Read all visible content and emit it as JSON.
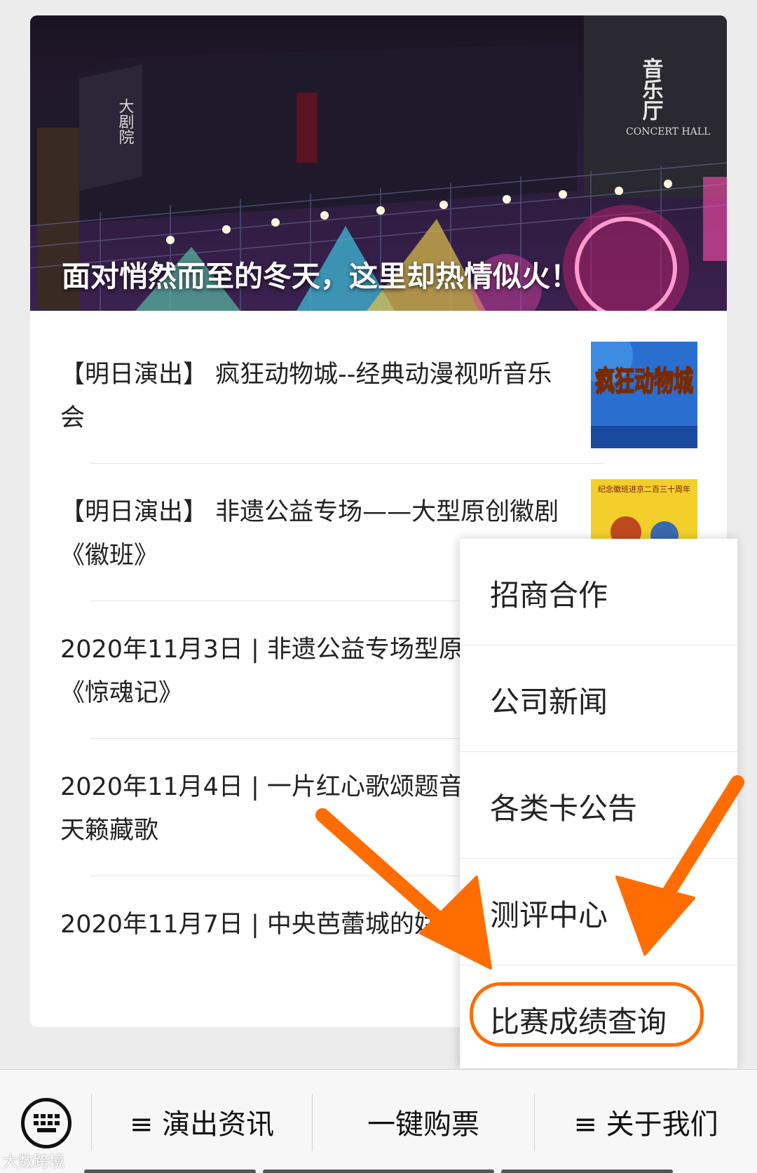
{
  "hero": {
    "title": "面对悄然而至的冬天，这里却热情似火！",
    "signs": {
      "concert_hall": "音乐厅",
      "concert_hall_en": "CONCERT HALL",
      "grand_theatre": "大剧院"
    }
  },
  "articles": [
    {
      "title": "【明日演出】 疯狂动物城--经典动漫视听音乐会"
    },
    {
      "title": "【明日演出】 非遗公益专场——大型原创徽剧《徽班》"
    },
    {
      "title": "2020年11月3日 | 非遗公益专场型原创徽剧《惊魂记》"
    },
    {
      "title": "2020年11月4日 | 一片红心歌颂题音乐会——天籁藏歌"
    },
    {
      "title": "2020年11月7日 | 中央芭蕾城的姑娘》《卡门》"
    }
  ],
  "thumbs": {
    "zootopia": "疯狂动物城",
    "huiban": "纪念徽班进京二百三十周年"
  },
  "popup_menu": {
    "items": [
      {
        "label": "招商合作"
      },
      {
        "label": "公司新闻"
      },
      {
        "label": "各类卡公告"
      },
      {
        "label": "测评中心"
      },
      {
        "label": "比赛成绩查询",
        "highlighted": true
      }
    ]
  },
  "tabbar": {
    "tabs": [
      {
        "label": "≡ 演出资讯"
      },
      {
        "label": "一键购票"
      },
      {
        "label": "≡ 关于我们"
      }
    ]
  },
  "watermark": "大数跨境",
  "colors": {
    "highlight": "#ff6c00",
    "arrow": "#ff6c00"
  }
}
